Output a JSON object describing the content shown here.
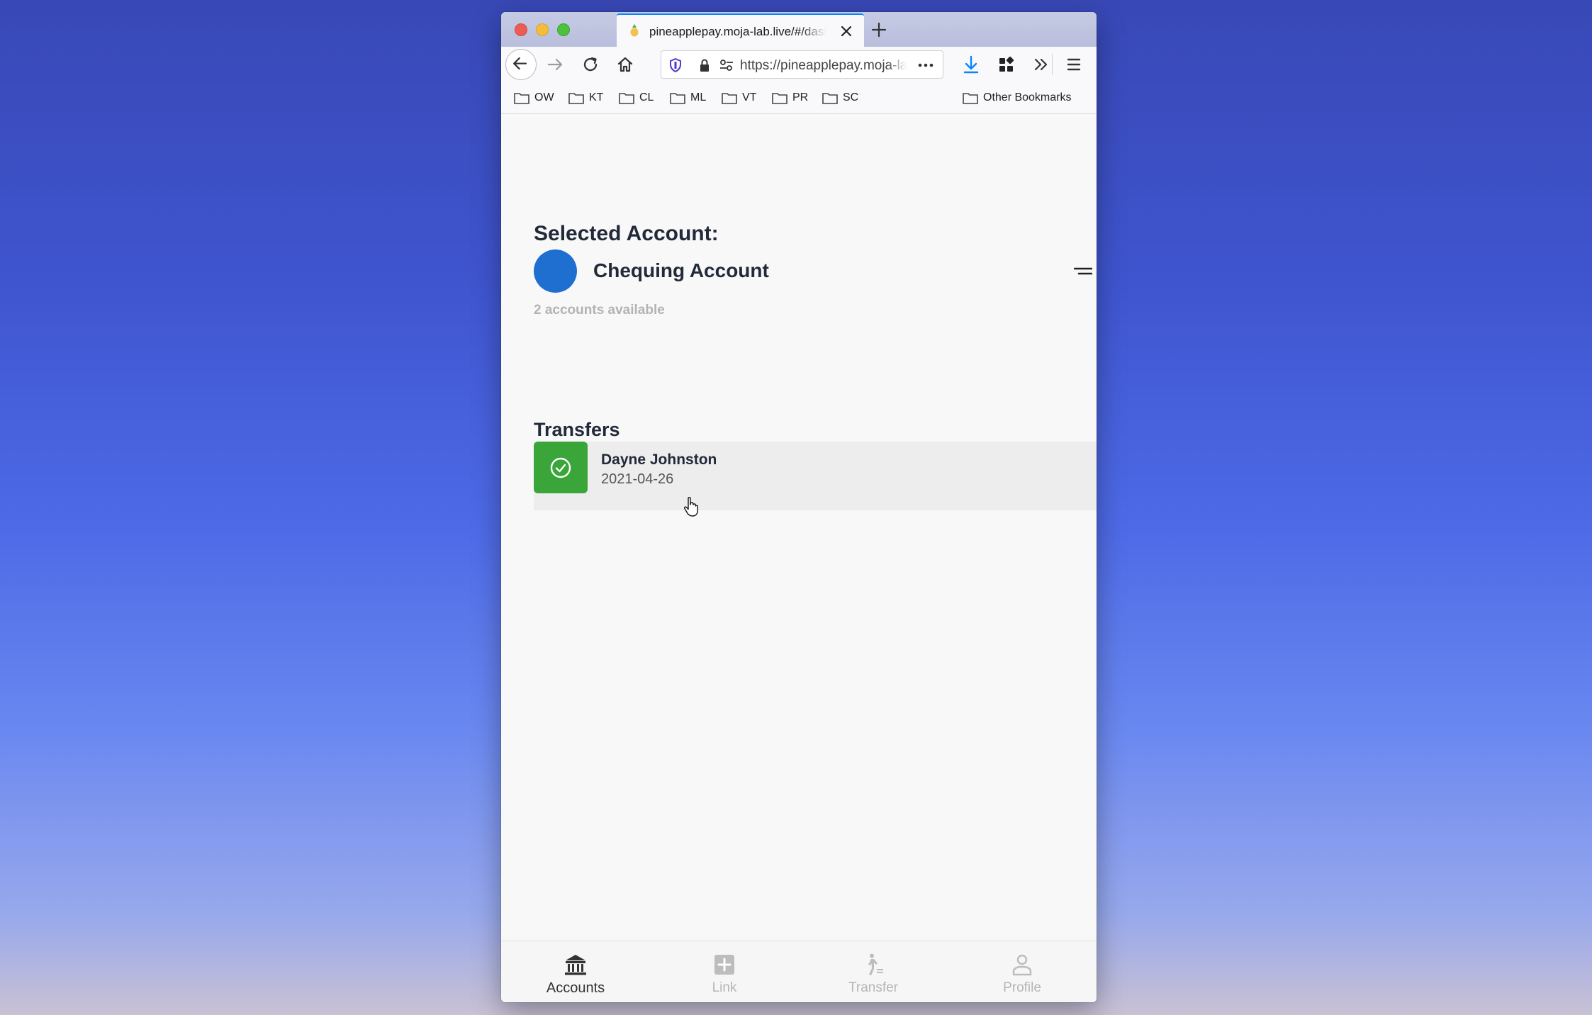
{
  "browser": {
    "tab_title": "pineapplepay.moja-lab.live/#/dashboard",
    "url": "https://pineapplepay.moja-lab.live/#/dashboard",
    "bookmarks": [
      "OW",
      "KT",
      "CL",
      "ML",
      "VT",
      "PR",
      "SC"
    ],
    "other_bookmarks": "Other Bookmarks"
  },
  "account": {
    "heading": "Selected Account:",
    "name": "Chequing Account",
    "accounts_available": "2 accounts available",
    "dot_color": "#1f6fd1"
  },
  "transfers": {
    "heading": "Transfers",
    "items": [
      {
        "name": "Dayne Johnston",
        "date": "2021-04-26",
        "status": "completed",
        "status_color": "#3aa63a"
      }
    ]
  },
  "bottom_nav": {
    "items": [
      {
        "label": "Accounts",
        "icon": "bank-icon",
        "active": true
      },
      {
        "label": "Link",
        "icon": "plus-square-icon",
        "active": false
      },
      {
        "label": "Transfer",
        "icon": "walking-person-icon",
        "active": false
      },
      {
        "label": "Profile",
        "icon": "person-icon",
        "active": false
      }
    ]
  },
  "colors": {
    "accent": "#0a84ff",
    "text_dark": "#222a3a",
    "muted": "#b3b3b3"
  }
}
